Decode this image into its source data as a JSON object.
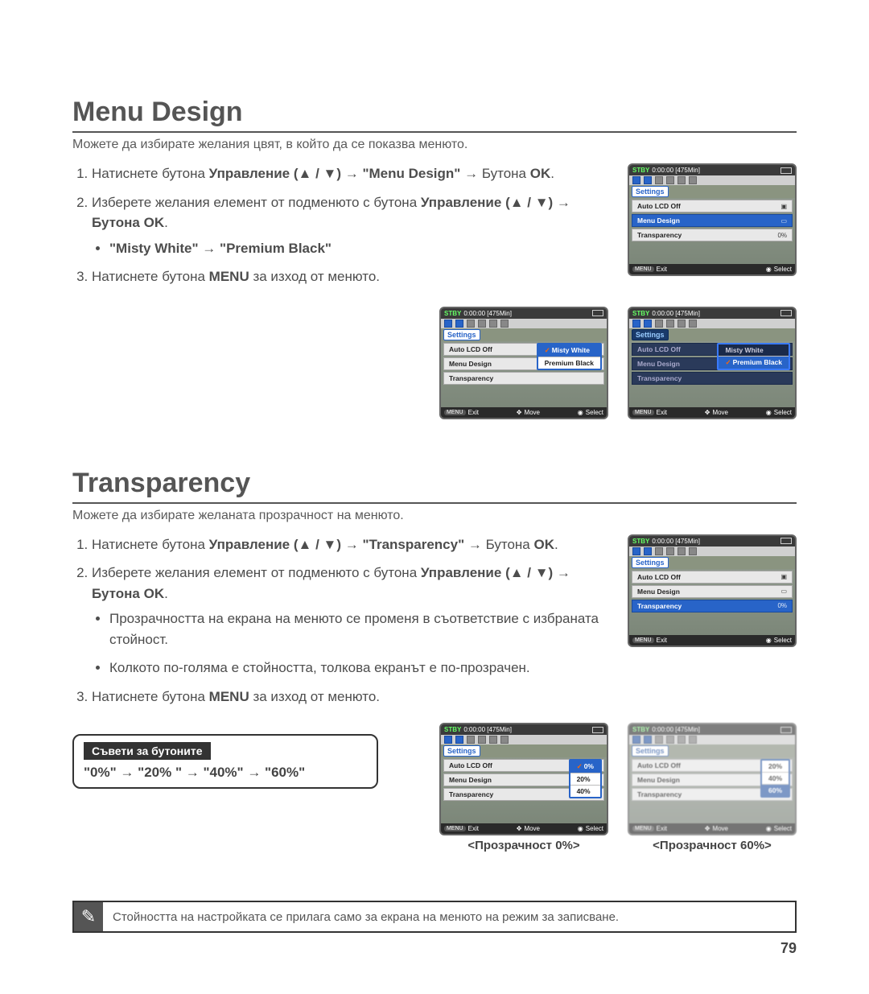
{
  "page_number": "79",
  "section1": {
    "title": "Menu Design",
    "intro": "Можете да избирате желания цвят, в който да се показва менюто.",
    "step1_a": "Натиснете бутона ",
    "step1_b": "Управление",
    "step1_c": " (▲ / ▼) → \"Menu Design\" → ",
    "step1_d": "Бутона ",
    "step1_e": "OK",
    "step1_f": ".",
    "step2_a": "Изберете желания елемент от подменюто с бутона ",
    "step2_b": "Управление",
    "step2_c": " (▲ / ▼) → Бутона ",
    "step2_d": "OK",
    "step2_e": ".",
    "step2_bullet": "\"Misty White\" → \"Premium Black\"",
    "step3_a": "Натиснете бутона ",
    "step3_b": "MENU",
    "step3_c": " за изход от менюто."
  },
  "section2": {
    "title": "Transparency",
    "intro": "Можете да избирате желаната прозрачност на менюто.",
    "step1_a": "Натиснете бутона ",
    "step1_b": "Управление",
    "step1_c": " (▲ / ▼) → \"Transparency\" → ",
    "step1_d": "Бутона ",
    "step1_e": "OK",
    "step1_f": ".",
    "step2_a": "Изберете желания елемент от подменюто с бутона ",
    "step2_b": "Управление",
    "step2_c": " (▲ / ▼) → Бутона ",
    "step2_d": "OK",
    "step2_e": ".",
    "step2_bullet1": "Прозрачността на екрана на менюто се променя в съответствие с избраната стойност.",
    "step2_bullet2": "Колкото по-голяма е стойността, толкова екранът е по-прозрачен.",
    "step3_a": "Натиснете бутона ",
    "step3_b": "MENU",
    "step3_c": " за изход от менюто.",
    "tips_label": "Съвети за бутоните",
    "tips_values": "\"0%\" → \"20% \" → \"40%\" → \"60%\"",
    "caption1": "<Прозрачност 0%>",
    "caption2": "<Прозрачност 60%>"
  },
  "note": "Стойността на настройката се прилага само за екрана на менюто на режим за записване.",
  "cam": {
    "stby": "STBY",
    "time": "0:00:00 [475Min]",
    "settings": "Settings",
    "menu": {
      "auto_lcd": "Auto LCD Off",
      "menu_design": "Menu Design",
      "transparency": "Transparency",
      "trans_val": "0%"
    },
    "foot_exit": "Exit",
    "foot_exit_pill": "MENU",
    "foot_move": "Move",
    "foot_select": "Select",
    "opts_design": {
      "white": "Misty White",
      "black": "Premium Black"
    },
    "opts_trans": {
      "o0": "0%",
      "o20": "20%",
      "o40": "40%",
      "o60": "60%"
    }
  }
}
